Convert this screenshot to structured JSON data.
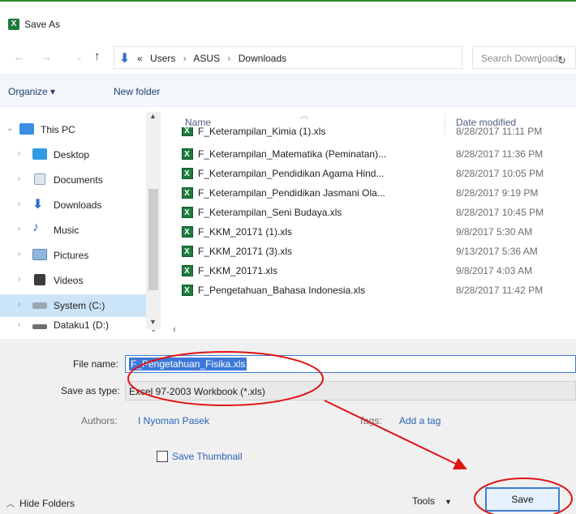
{
  "window": {
    "title": "Save As"
  },
  "nav": {
    "crumbs": [
      "Users",
      "ASUS",
      "Downloads"
    ],
    "crumb_prefix": "«",
    "search_placeholder": "Search Downloads"
  },
  "toolbar": {
    "organize_label": "Organize ▾",
    "new_folder_label": "New folder"
  },
  "sidebar": {
    "items": [
      {
        "label": "This PC",
        "icon": "monitor-icon",
        "chevron": "⌄"
      },
      {
        "label": "Desktop",
        "icon": "desktop-icon",
        "chevron": "›"
      },
      {
        "label": "Documents",
        "icon": "documents-icon",
        "chevron": "›"
      },
      {
        "label": "Downloads",
        "icon": "downloads-icon",
        "chevron": "›"
      },
      {
        "label": "Music",
        "icon": "music-icon",
        "chevron": "›"
      },
      {
        "label": "Pictures",
        "icon": "pictures-icon",
        "chevron": "›"
      },
      {
        "label": "Videos",
        "icon": "videos-icon",
        "chevron": "›"
      },
      {
        "label": "System (C:)",
        "icon": "drive-icon",
        "chevron": "›"
      },
      {
        "label": "Dataku1 (D:)",
        "icon": "drive-icon",
        "chevron": "›"
      }
    ]
  },
  "file_list": {
    "columns": {
      "name": "Name",
      "date": "Date modified"
    },
    "rows": [
      {
        "name": "F_Keterampilan_Kimia (1).xls",
        "date": "8/28/2017 11:11 PM"
      },
      {
        "name": "F_Keterampilan_Matematika (Peminatan)...",
        "date": "8/28/2017 11:36 PM"
      },
      {
        "name": "F_Keterampilan_Pendidikan Agama Hind...",
        "date": "8/28/2017 10:05 PM"
      },
      {
        "name": "F_Keterampilan_Pendidikan Jasmani Ola...",
        "date": "8/28/2017 9:19 PM"
      },
      {
        "name": "F_Keterampilan_Seni Budaya.xls",
        "date": "8/28/2017 10:45 PM"
      },
      {
        "name": "F_KKM_20171 (1).xls",
        "date": "9/8/2017 5:30 AM"
      },
      {
        "name": "F_KKM_20171 (3).xls",
        "date": "9/13/2017 5:36 AM"
      },
      {
        "name": "F_KKM_20171.xls",
        "date": "9/8/2017 4:03 AM"
      },
      {
        "name": "F_Pengetahuan_Bahasa Indonesia.xls",
        "date": "8/28/2017 11:42 PM"
      }
    ]
  },
  "form": {
    "file_name_label": "File name:",
    "file_name_value": "F_Pengetahuan_Fisika.xls",
    "save_type_label": "Save as type:",
    "save_type_value": "Excel 97-2003 Workbook (*.xls)",
    "authors_label": "Authors:",
    "authors_value": "I Nyoman Pasek",
    "tags_label": "Tags:",
    "tags_value": "Add a tag",
    "thumbnail_label": "Save Thumbnail",
    "hide_folders_label": "Hide Folders",
    "tools_label": "Tools",
    "save_label": "Save"
  },
  "annotation": {
    "color": "#e01414"
  }
}
